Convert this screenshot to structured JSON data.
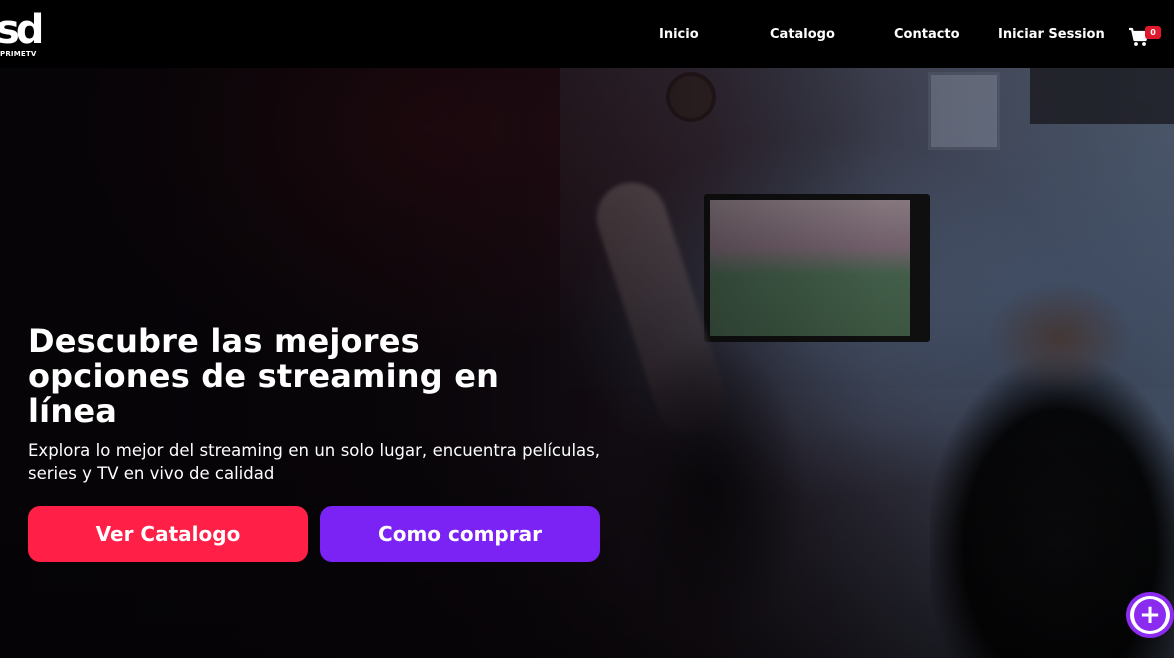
{
  "logo": {
    "mark": "sd",
    "sub": "PRIMETV"
  },
  "nav": {
    "items": [
      {
        "label": "Inicio"
      },
      {
        "label": "Catalogo"
      },
      {
        "label": "Contacto"
      },
      {
        "label": "Iniciar Session"
      }
    ],
    "cart_count": "0"
  },
  "hero": {
    "title": "Descubre las mejores opciones de streaming en línea",
    "description": "Explora lo mejor del streaming en un solo lugar, encuentra películas, series y TV en vivo de calidad",
    "primary_button": "Ver Catalogo",
    "secondary_button": "Como comprar"
  },
  "fab": {
    "icon": "plus-icon",
    "symbol": "+"
  },
  "colors": {
    "primary_button": "#ff1f47",
    "secondary_button": "#7b23f5",
    "cart_badge": "#e1192c",
    "fab_accent": "#8b2bf0",
    "header_bg": "#000000"
  }
}
